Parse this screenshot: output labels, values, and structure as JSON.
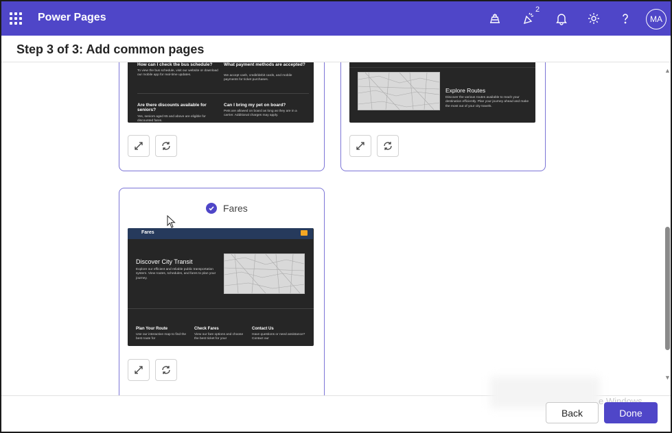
{
  "app": {
    "title": "Power Pages",
    "user_initials": "MA",
    "notification_count": "2"
  },
  "header": {
    "step_title": "Step 3 of 3: Add common pages"
  },
  "cards": {
    "faq": {
      "q1": "How can I check the bus schedule?",
      "a1": "To view the bus schedule, visit our website or download our mobile app for real-time updates.",
      "q2": "What payment methods are accepted?",
      "a2": "We accept cash, credit/debit cards, and mobile payments for ticket purchases.",
      "q3": "Are there discounts available for seniors?",
      "a3": "Yes, seniors aged 65 and above are eligible for discounted fares.",
      "q4": "Can I bring my pet on board?",
      "a4": "Pets are allowed on board as long as they are in a carrier. Additional charges may apply."
    },
    "routes": {
      "heading": "Explore Routes",
      "body": "Discover the various routes available to reach your destination efficiently. Plan your journey ahead and make the most out of your city travels."
    },
    "fares": {
      "label": "Fares",
      "nav_title": "Fares",
      "hero_title": "Discover City Transit",
      "hero_body": "Explore our efficient and reliable public transportation system. View routes, schedules, and fares to plan your journey.",
      "col1_title": "Plan Your Route",
      "col1_body": "Use our interactive map to find the best route for",
      "col2_title": "Check Fares",
      "col2_body": "View our fare options and choose the best ticket for your",
      "col3_title": "Contact Us",
      "col3_body": "Have questions or need assistance? Contact our"
    }
  },
  "footer": {
    "back_label": "Back",
    "done_label": "Done",
    "watermark": "e Windows."
  },
  "icons": [
    "apps-grid-icon",
    "diagnostics-icon",
    "celebrate-icon",
    "bell-icon",
    "gear-icon",
    "help-icon",
    "expand-icon",
    "refresh-icon",
    "check-icon"
  ],
  "colors": {
    "brand": "#4f46c8",
    "card_border": "#7a73d6",
    "preview_bg": "#262626"
  }
}
